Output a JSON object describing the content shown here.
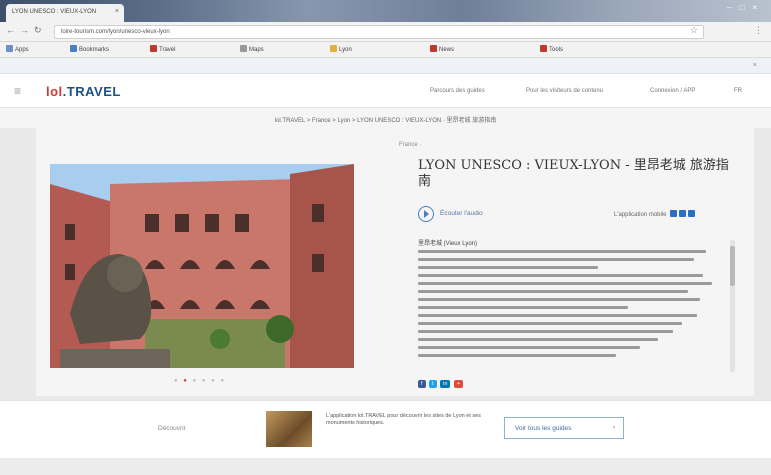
{
  "browser": {
    "tab_title": "LYON UNESCO : VIEUX-LYON",
    "url": "loire-tourism.com/lyon/unesco-vieux-lyon",
    "bookmarks": [
      "Apps",
      "Bookmarks",
      "Travel",
      "Maps",
      "Lyon",
      "News",
      "Tools"
    ]
  },
  "cookie_banner": {
    "text": "",
    "link": ""
  },
  "header": {
    "logo_part1": "lol",
    "logo_part2": ".TRAVEL",
    "nav": [
      "Parcours des guides",
      "Pour les visiteurs de contenu",
      "Connexion / APP",
      "FR"
    ]
  },
  "breadcrumb": "lol.TRAVEL > France > Lyon > LYON UNESCO : VIEUX-LYON · 里昂老城 旅游指南",
  "main": {
    "kicker": "France ·",
    "title": "LYON UNESCO : VIEUX-LYON - 里昂老城 旅游指南",
    "audio_label": "Écouter l'audio",
    "store_label": "L'application mobile",
    "text_heading": "里昂老城 (Vieux Lyon)",
    "share": [
      "f",
      "t",
      "in",
      "+"
    ]
  },
  "bottom": {
    "kicker": "Découvrir",
    "promo_text": "L'application lol.TRAVEL pour découvrir les sites de Lyon et ses monuments historiques.",
    "button_label": "Voir tous les guides"
  },
  "colors": {
    "brand_red": "#d23a3a",
    "brand_blue": "#1f4e8c",
    "accent_blue": "#4a7fc1"
  }
}
